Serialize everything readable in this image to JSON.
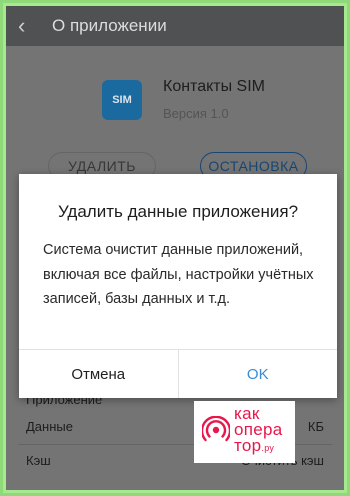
{
  "header": {
    "title": "О приложении"
  },
  "app": {
    "icon_text": "SIM",
    "name": "Контакты SIM",
    "version": "Версия 1.0",
    "delete_label": "УДАЛИТЬ",
    "stop_label": "ОСТАНОВКА"
  },
  "storage": {
    "rows": [
      {
        "label": "Приложение",
        "value": ""
      },
      {
        "label": "Данные",
        "value": "КБ"
      },
      {
        "label": "Кэш",
        "value": "Очистить кэш"
      }
    ]
  },
  "dialog": {
    "title": "Удалить данные приложения?",
    "message": "Система очистит данные приложений, включая все файлы, настройки учётных записей, базы данных и т.д.",
    "cancel_label": "Отмена",
    "ok_label": "OK"
  },
  "watermark": {
    "line1": "как",
    "line2": "опера",
    "line3": "тор",
    "suffix": ".ру"
  },
  "colors": {
    "accent": "#3a8ad6",
    "watermark": "#e8174b",
    "app_icon": "#1c6fa8"
  }
}
